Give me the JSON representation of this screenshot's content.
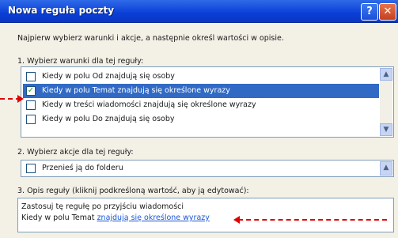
{
  "window": {
    "title": "Nowa reguła poczty",
    "help_label": "?",
    "close_label": "✕"
  },
  "intro_text": "Najpierw wybierz warunki i akcje, a następnie określ wartości w opisie.",
  "step1": {
    "label": "1. Wybierz warunki dla tej reguły:",
    "items": [
      {
        "label": "Kiedy w polu Od znajdują się osoby",
        "checked": false
      },
      {
        "label": "Kiedy w polu Temat znajdują się określone wyrazy",
        "checked": true
      },
      {
        "label": "Kiedy w treści wiadomości znajdują się określone wyrazy",
        "checked": false
      },
      {
        "label": "Kiedy w polu Do znajdują się osoby",
        "checked": false
      }
    ]
  },
  "step2": {
    "label": "2. Wybierz akcje dla tej reguły:",
    "items": [
      {
        "label": "Przenieś ją do folderu",
        "checked": false
      }
    ]
  },
  "step3": {
    "label": "3. Opis reguły (kliknij podkreśloną wartość, aby ją edytować):",
    "line1": "Zastosuj tę regułę po przyjściu wiadomości",
    "line2_prefix": "Kiedy w polu Temat ",
    "line2_link": "znajdują się określone wyrazy"
  },
  "icons": {
    "check": "✓",
    "scroll_up": "▲",
    "scroll_down": "▼"
  },
  "colors": {
    "titlebar": "#0a3fd6",
    "selection": "#316ac5",
    "annotation_arrow": "#e00000",
    "link": "#1a56d6"
  }
}
